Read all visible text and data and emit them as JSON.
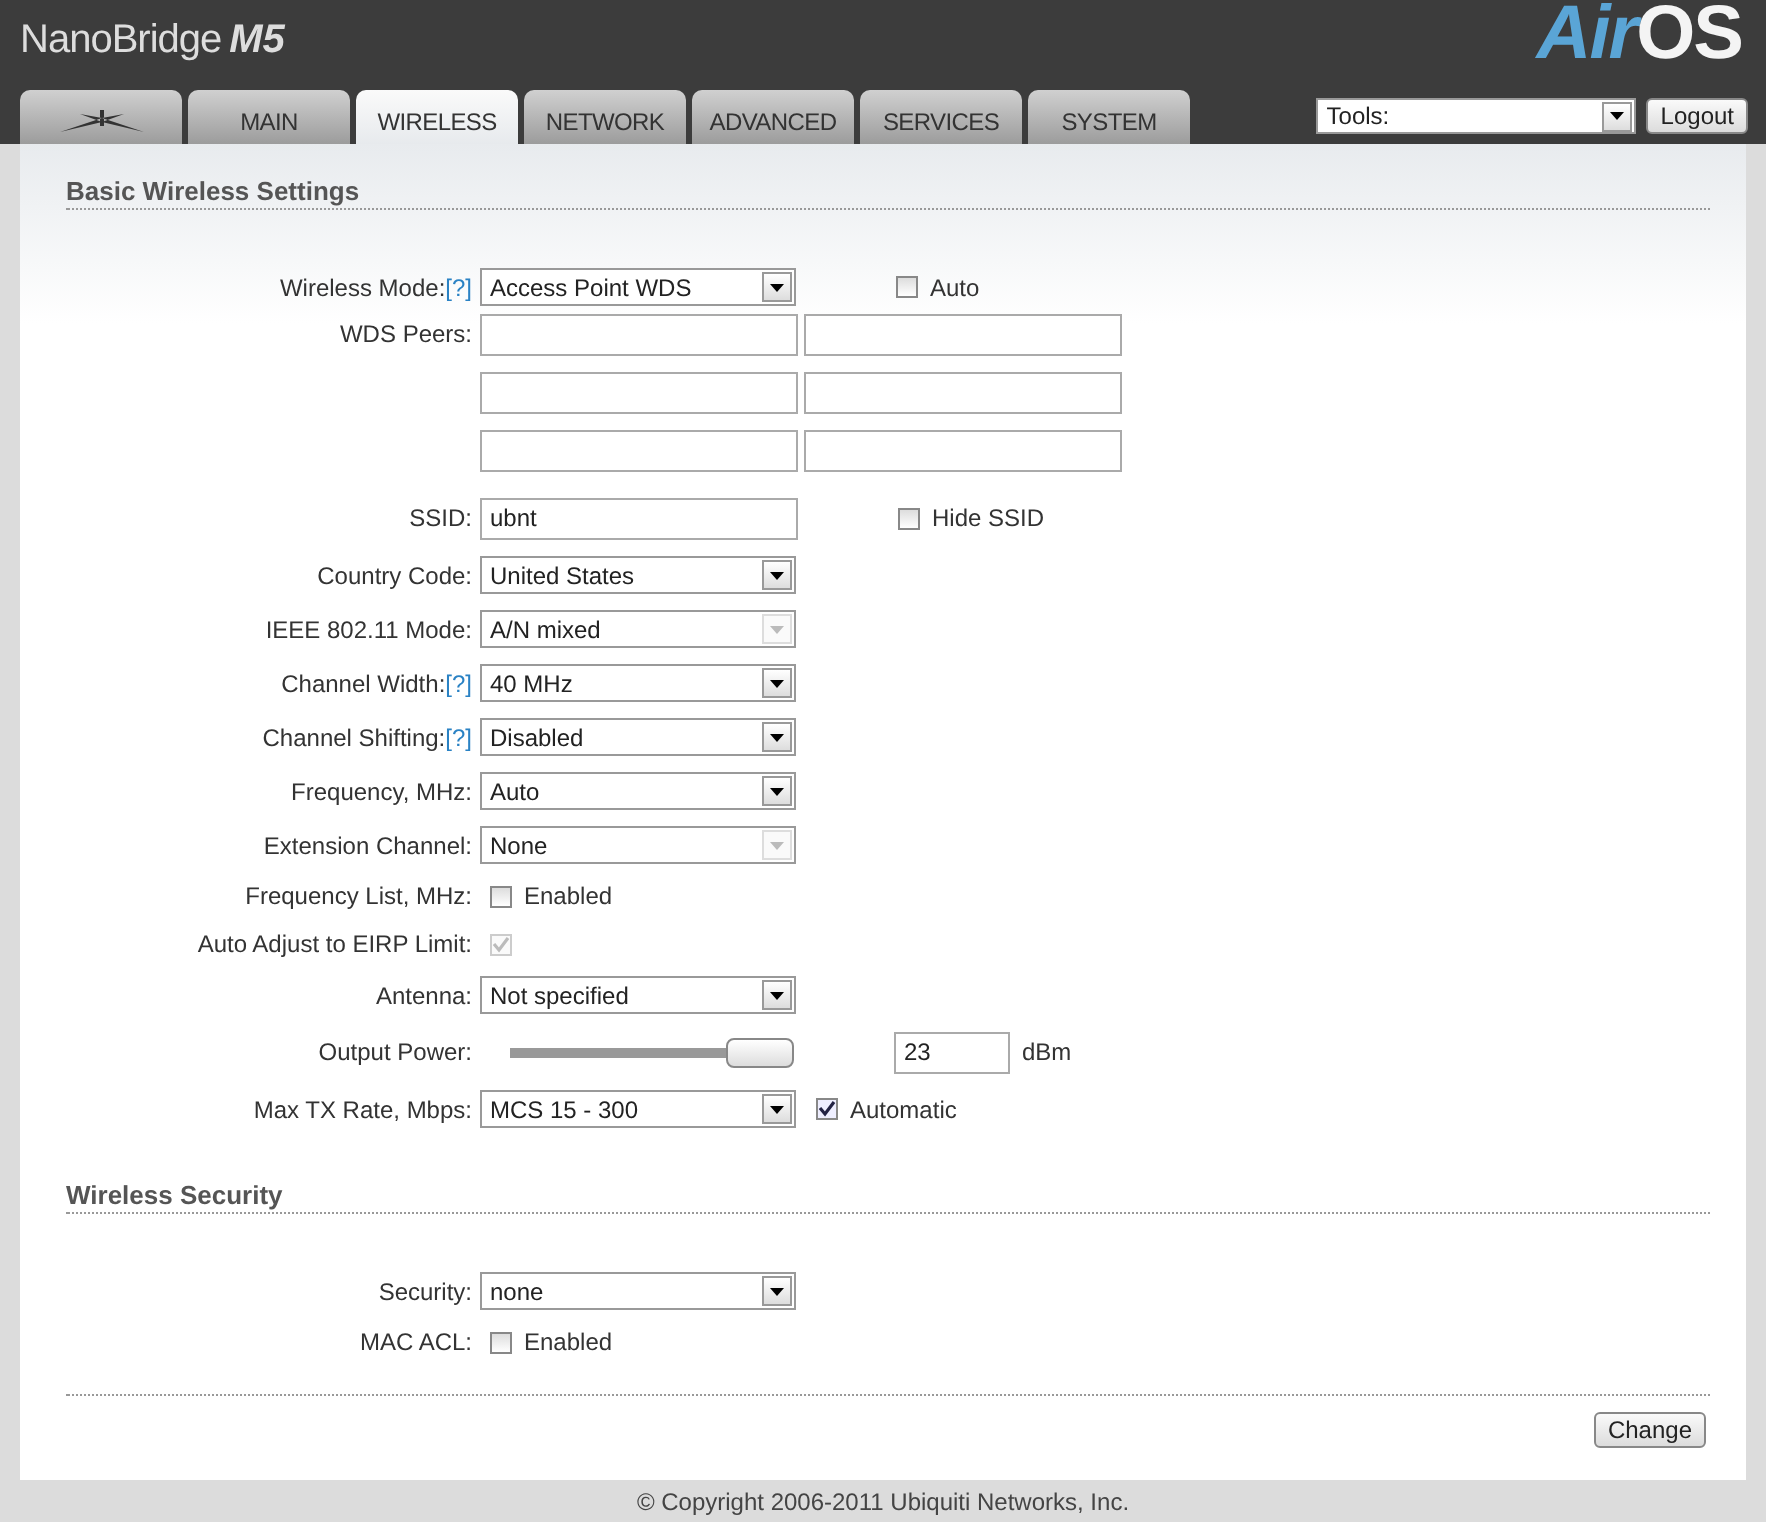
{
  "header": {
    "product": "NanoBridge",
    "model": "M5",
    "logo_main": "Air",
    "logo_tail": "OS"
  },
  "tabs": [
    {
      "kind": "icon",
      "selected": false
    },
    {
      "kind": "text",
      "label": "MAIN",
      "selected": false
    },
    {
      "kind": "text",
      "label": "WIRELESS",
      "selected": true
    },
    {
      "kind": "text",
      "label": "NETWORK",
      "selected": false
    },
    {
      "kind": "text",
      "label": "ADVANCED",
      "selected": false
    },
    {
      "kind": "text",
      "label": "SERVICES",
      "selected": false
    },
    {
      "kind": "text",
      "label": "SYSTEM",
      "selected": false
    }
  ],
  "tools": {
    "value": "Tools:"
  },
  "logout": "Logout",
  "sections": [
    {
      "title": "Basic Wireless Settings",
      "rows": [
        {
          "kind": "select",
          "label": "Wireless Mode:",
          "help": "[?]",
          "value": "Access Point WDS",
          "disabled": false,
          "option": {
            "label": "Auto",
            "checked": false
          }
        },
        {
          "kind": "peers",
          "label": "WDS Peers:",
          "fields": [
            [
              {
                "kind": "input"
              },
              {
                "kind": "input"
              }
            ],
            [
              {
                "kind": "input"
              },
              {
                "kind": "input"
              }
            ],
            [
              {
                "kind": "input"
              },
              {
                "kind": "input"
              }
            ]
          ]
        },
        {
          "kind": "text",
          "label": "SSID:",
          "value": "ubnt",
          "option": {
            "label": "Hide SSID",
            "checked": false
          }
        },
        {
          "kind": "select",
          "label": "Country Code:",
          "value": "United States",
          "disabled": false
        },
        {
          "kind": "select",
          "label": "IEEE 802.11 Mode:",
          "value": "A/N mixed",
          "disabled": true
        },
        {
          "kind": "select",
          "label": "Channel Width:",
          "help": "[?]",
          "value": "40 MHz",
          "disabled": false
        },
        {
          "kind": "select",
          "label": "Channel Shifting:",
          "help": "[?]",
          "value": "Disabled",
          "disabled": false
        },
        {
          "kind": "select",
          "label": "Frequency, MHz:",
          "value": "Auto",
          "disabled": false
        },
        {
          "kind": "select",
          "label": "Extension Channel:",
          "value": "None",
          "disabled": true
        },
        {
          "kind": "checkbox",
          "label": "Frequency List, MHz:",
          "text": "Enabled",
          "checked": false,
          "disabled": false
        },
        {
          "kind": "checkbox",
          "label": "Auto Adjust to EIRP Limit:",
          "checked": true,
          "disabled": true
        },
        {
          "kind": "select",
          "label": "Antenna:",
          "value": "Not specified",
          "disabled": false
        },
        {
          "kind": "slider",
          "label": "Output Power:",
          "level": 1,
          "value": "23",
          "unit": "dBm"
        },
        {
          "kind": "select",
          "label": "Max TX Rate, Mbps:",
          "value": "MCS 15 - 300",
          "disabled": false,
          "inline_option": {
            "label": "Automatic",
            "checked": true
          }
        }
      ]
    },
    {
      "title": "Wireless Security",
      "rows": [
        {
          "kind": "select",
          "label": "Security:",
          "value": "none",
          "disabled": false
        },
        {
          "kind": "checkbox",
          "label": "MAC ACL:",
          "text": "Enabled",
          "checked": false,
          "disabled": false
        }
      ]
    }
  ],
  "change": "Change",
  "footer": "© Copyright 2006-2011 Ubiquiti Networks, Inc."
}
